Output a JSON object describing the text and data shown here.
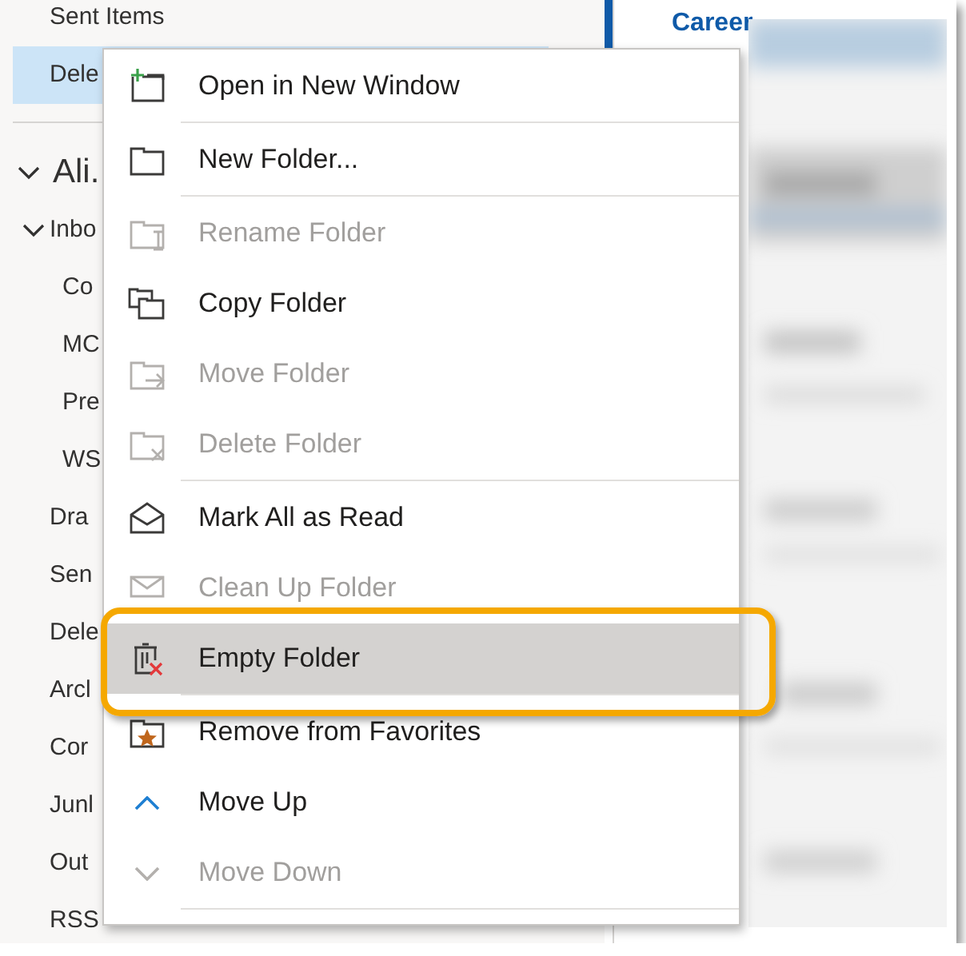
{
  "folder_pane": {
    "items": [
      {
        "label": "Sent Items",
        "selected": false
      },
      {
        "label": "Dele",
        "selected": true
      }
    ],
    "account": {
      "label": "Ali.",
      "expanded": true,
      "children": [
        {
          "label": "Inbo",
          "expanded": true,
          "children": [
            {
              "label": "Co"
            },
            {
              "label": "MC"
            },
            {
              "label": "Pre"
            },
            {
              "label": "WS"
            }
          ]
        },
        {
          "label": "Dra"
        },
        {
          "label": "Sen"
        },
        {
          "label": "Dele"
        },
        {
          "label": "Arcl"
        },
        {
          "label": "Cor"
        },
        {
          "label": "Junl"
        },
        {
          "label": "Out"
        },
        {
          "label": "RSS"
        }
      ]
    }
  },
  "message_list": {
    "heading": "Career"
  },
  "context_menu": {
    "items": [
      {
        "kind": "window",
        "label": "Open in New Window",
        "disabled": false,
        "selected": false,
        "separator_after": true
      },
      {
        "kind": "folder",
        "label": "New Folder...",
        "disabled": false,
        "selected": false,
        "separator_after": true
      },
      {
        "kind": "rename",
        "label": "Rename Folder",
        "disabled": true,
        "selected": false,
        "separator_after": false
      },
      {
        "kind": "copy",
        "label": "Copy Folder",
        "disabled": false,
        "selected": false,
        "separator_after": false
      },
      {
        "kind": "move",
        "label": "Move Folder",
        "disabled": true,
        "selected": false,
        "separator_after": false
      },
      {
        "kind": "delete",
        "label": "Delete Folder",
        "disabled": true,
        "selected": false,
        "separator_after": true
      },
      {
        "kind": "read",
        "label": "Mark All as Read",
        "disabled": false,
        "selected": false,
        "separator_after": false
      },
      {
        "kind": "cleanup",
        "label": "Clean Up Folder",
        "disabled": true,
        "selected": false,
        "separator_after": false
      },
      {
        "kind": "empty",
        "label": "Empty Folder",
        "disabled": false,
        "selected": true,
        "separator_after": true
      },
      {
        "kind": "favorite",
        "label": "Remove from Favorites",
        "disabled": false,
        "selected": false,
        "separator_after": false
      },
      {
        "kind": "up",
        "label": "Move Up",
        "disabled": false,
        "selected": false,
        "separator_after": false
      },
      {
        "kind": "down",
        "label": "Move Down",
        "disabled": true,
        "selected": false,
        "separator_after": true
      }
    ]
  }
}
